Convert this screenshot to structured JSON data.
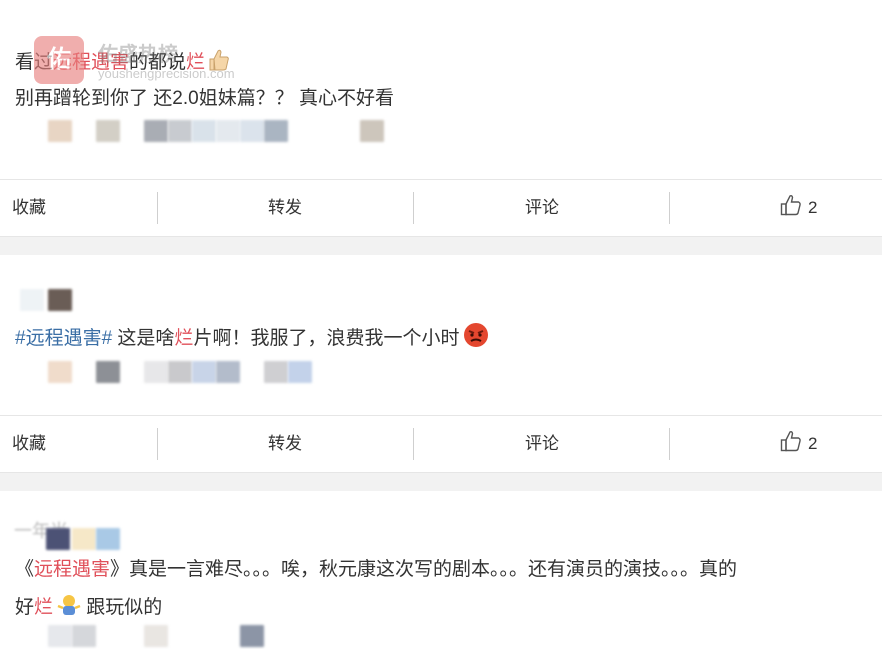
{
  "posts": [
    {
      "line1": {
        "a": "看过",
        "b": "远程遇害",
        "c": "的都说",
        "d": "烂"
      },
      "line2": "别再蹭轮到你了 还2.0姐妹篇？？ 真心不好看",
      "actions": {
        "favorite": "收藏",
        "repost": "转发",
        "comment": "评论",
        "likes": "2"
      }
    },
    {
      "line1": {
        "tag": "#远程遇害#",
        "a": " 这是啥",
        "b": "烂",
        "c": "片啊！我服了，浪费我一个小时"
      },
      "actions": {
        "favorite": "收藏",
        "repost": "转发",
        "comment": "评论",
        "likes": "2"
      }
    },
    {
      "author_partial": "一年当",
      "line1": {
        "a": "《",
        "b": "远程遇害",
        "c": "》真是一言难尽。。。唉，秋元康这次写的剧本。。。还有演员的演技。。。真的"
      },
      "line2": {
        "a": "好",
        "b": "烂",
        "c": " 跟玩似的"
      }
    }
  ],
  "watermark": {
    "logo": "佑",
    "title": "佑盛热榜",
    "url": "youshengprecision.com"
  },
  "colors": {
    "highlight": "#e0505a",
    "tag": "#3a6ea5",
    "divider": "#f2f2f2"
  }
}
